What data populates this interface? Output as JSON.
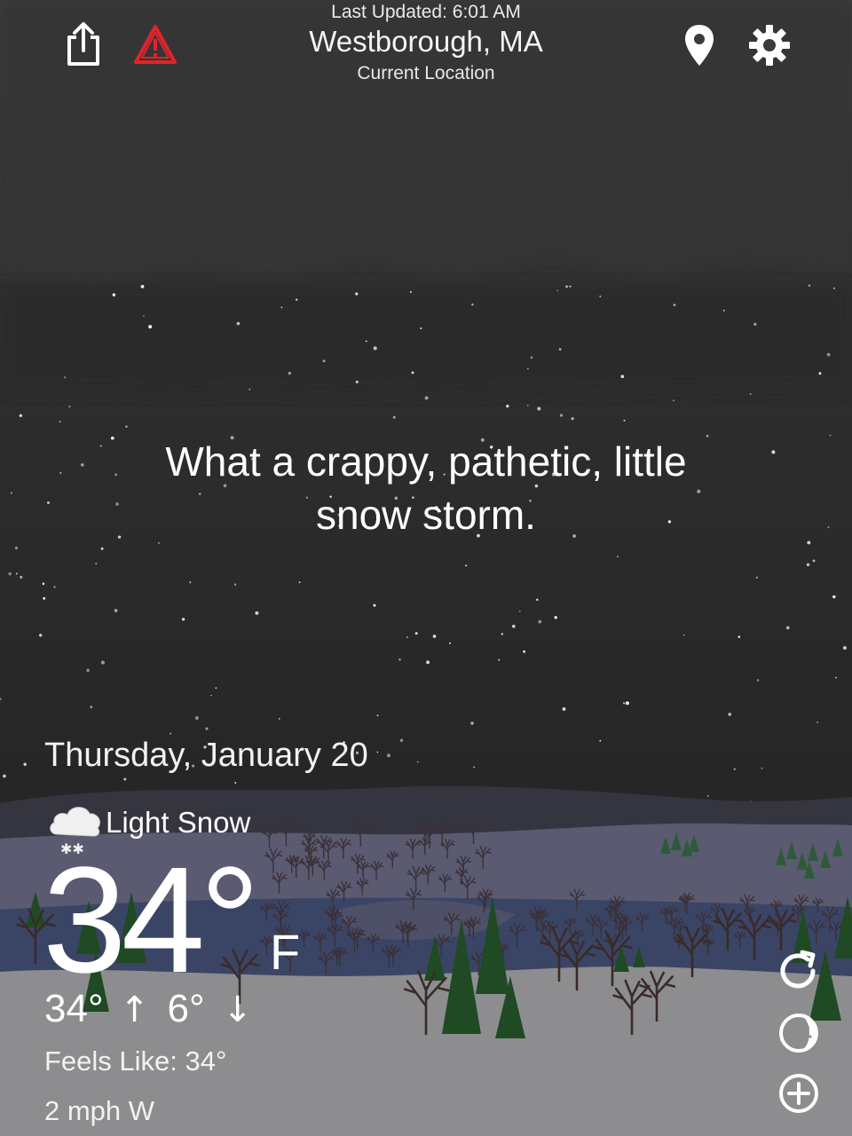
{
  "header": {
    "last_updated": "Last Updated: 6:01 AM",
    "location": "Westborough, MA",
    "location_subtitle": "Current Location"
  },
  "toolbar": {
    "share_icon": "share-icon",
    "alert_icon": "warning-triangle-icon",
    "location_pin_icon": "map-pin-icon",
    "settings_icon": "gear-icon"
  },
  "quip": "What a crappy, pathetic, little snow storm.",
  "forecast": {
    "date": "Thursday, January 20",
    "condition": "Light Snow",
    "condition_icon": "snow-cloud-icon",
    "temperature": "34°",
    "unit": "F",
    "high": "34°",
    "high_arrow": "↑",
    "low": "6°",
    "low_arrow": "↓",
    "feels_like": "Feels Like: 34°",
    "wind": "2 mph W"
  },
  "side_actions": {
    "refresh_icon": "refresh-icon",
    "moon_icon": "moon-phase-icon",
    "add_icon": "add-circle-icon"
  },
  "colors": {
    "sky_top": "#3b3b3b",
    "sky_bottom": "#202020",
    "alert": "#e0242b",
    "pine": "#1f4a24",
    "ground": "#8d8d8f"
  }
}
